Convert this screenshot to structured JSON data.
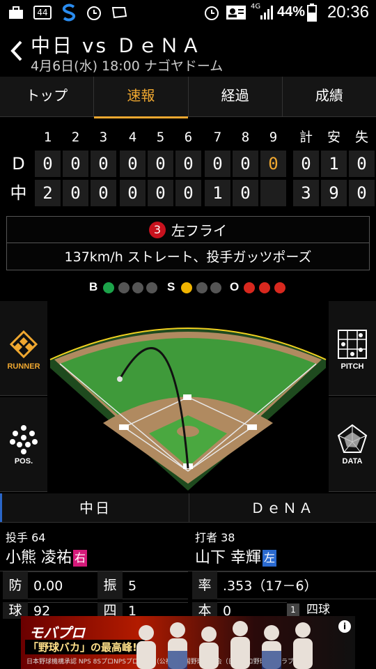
{
  "status_bar": {
    "network": "4G",
    "sim_badge": "44",
    "battery": "44%",
    "time": "20:36"
  },
  "header": {
    "title": "中日 vs ＤｅＮＡ",
    "subtitle": "4月6日(水) 18:00 ナゴヤドーム"
  },
  "tabs": [
    {
      "label": "トップ"
    },
    {
      "label": "速報"
    },
    {
      "label": "経過"
    },
    {
      "label": "成績"
    }
  ],
  "scoreboard": {
    "innings": [
      "1",
      "2",
      "3",
      "4",
      "5",
      "6",
      "7",
      "8",
      "9"
    ],
    "totals_headers": [
      "計",
      "安",
      "失"
    ],
    "rows": [
      {
        "team": "D",
        "scores": [
          "0",
          "0",
          "0",
          "0",
          "0",
          "0",
          "0",
          "0",
          "0"
        ],
        "totals": [
          "0",
          "1",
          "0"
        ]
      },
      {
        "team": "中",
        "scores": [
          "2",
          "0",
          "0",
          "0",
          "0",
          "0",
          "1",
          "0",
          ""
        ],
        "totals": [
          "3",
          "9",
          "0"
        ]
      }
    ]
  },
  "play": {
    "outs": "3",
    "result": "左フライ",
    "detail": "137km/h ストレート、投手ガッツポーズ"
  },
  "count": {
    "labels": {
      "b": "B",
      "s": "S",
      "o": "O"
    },
    "balls": 1,
    "strikes": 1,
    "outs": 3
  },
  "side_buttons": {
    "runner": "RUNNER",
    "pos": "POS.",
    "pitch": "PITCH",
    "data": "DATA"
  },
  "teams_bar": {
    "left": "中日",
    "right": "ＤｅＮＡ"
  },
  "pitcher": {
    "role": "投手",
    "number": "64",
    "name": "小熊 凌祐",
    "hand": "右",
    "stats": [
      {
        "k": "防",
        "v": "0.00"
      },
      {
        "k": "振",
        "v": "5"
      }
    ]
  },
  "batter": {
    "role": "打者",
    "number": "38",
    "name": "山下 幸輝",
    "hand": "左",
    "stats": [
      {
        "k": "率",
        "v": ".353（17－6）"
      }
    ]
  },
  "partial_row": {
    "k1": "球",
    "v1": "92",
    "k2": "四",
    "v2": "1",
    "k3": "本",
    "v3": "0",
    "badge": "1",
    "label": "四球"
  },
  "ad": {
    "brand": "モバプロ",
    "catch": "「野球バカ」の最高峰!!",
    "small": "日本野球機構承認 NPS 8SプロNPSプロ野球 （公社）全国野球振興会（日本プロ野球OBクラブ）公認",
    "info": "i"
  },
  "colors": {
    "accent": "#f0a830",
    "ball": "#1ca34a",
    "strike": "#f0b400",
    "out": "#d8281e",
    "field_green": "#3f9a3a",
    "dirt": "#b08a60"
  }
}
